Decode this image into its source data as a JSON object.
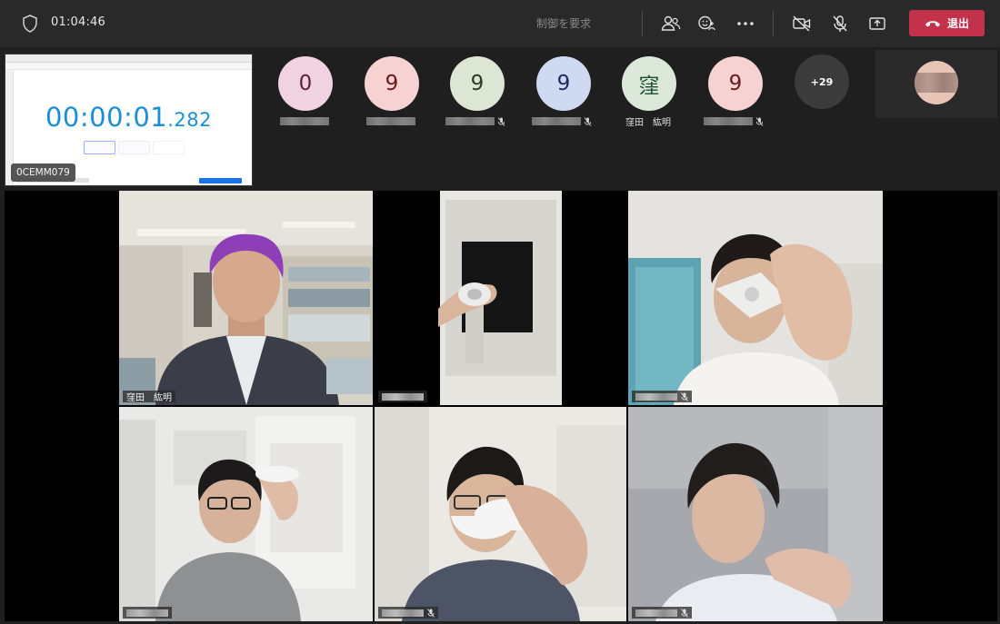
{
  "toolbar": {
    "elapsed_time": "01:04:46",
    "request_control_label": "制御を要求",
    "leave_label": "退出",
    "colors": {
      "leave": "#c4314b",
      "bar": "#292929"
    }
  },
  "shared_screen": {
    "presenter": "0CEMM079",
    "stopwatch_main": "00:00:01",
    "stopwatch_fraction": ".282"
  },
  "strip": {
    "participants": [
      {
        "initial": "0",
        "bg": "#f0d2e0",
        "fg": "#5b1f45"
      },
      {
        "initial": "9",
        "bg": "#f7d2d2",
        "fg": "#6b1a1a"
      },
      {
        "initial": "9",
        "bg": "#dde6d4",
        "fg": "#2f3b22"
      },
      {
        "initial": "9",
        "bg": "#d0d9f2",
        "fg": "#1d2b5e"
      },
      {
        "initial": "窪",
        "bg": "#dbe8da",
        "fg": "#1e4d34",
        "name": "窪田　紘明"
      },
      {
        "initial": "9",
        "bg": "#f7d2d2",
        "fg": "#6b1a1a"
      }
    ],
    "overflow_count": "+29"
  },
  "video_grid": {
    "tiles": [
      {
        "name": "窪田　紘明"
      }
    ]
  }
}
